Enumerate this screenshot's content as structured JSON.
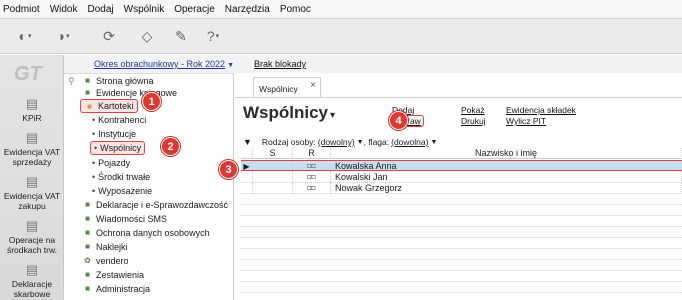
{
  "menu": [
    "Podmiot",
    "Widok",
    "Dodaj",
    "Wspólnik",
    "Operacje",
    "Narzędzia",
    "Pomoc"
  ],
  "toolbar": {
    "icons": [
      "back-icon",
      "forward-icon",
      "refresh-icon",
      "eraser-icon",
      "tools-icon",
      "help-icon"
    ]
  },
  "leftbar": {
    "logo": "GT",
    "items": [
      {
        "label": "KPiR",
        "icon": "books-icon"
      },
      {
        "label": "Ewidencja VAT sprzedaży",
        "icon": "sales-icon"
      },
      {
        "label": "Ewidencja VAT zakupu",
        "icon": "purchase-icon"
      },
      {
        "label": "Operacje na środkach trw.",
        "icon": "assets-icon"
      },
      {
        "label": "Deklaracje skarbowe",
        "icon": "declarations-icon"
      }
    ]
  },
  "infobar": {
    "period": "Okres obrachunkowy - Rok 2022",
    "lock": "Brak blokady"
  },
  "tree": {
    "items": [
      "Strona główna",
      "Ewidencje księgowe",
      "Kartoteki",
      "Kontrahenci",
      "Instytucje",
      "Wspólnicy",
      "Pojazdy",
      "Środki trwałe",
      "Wyposażenie",
      "Deklaracje i e-Sprawozdawczość",
      "Wiadomości SMS",
      "Ochrona danych osobowych",
      "Naklejki",
      "vendero",
      "Zestawienia",
      "Administracja"
    ]
  },
  "tab": {
    "label": "Wspólnicy",
    "close": "×"
  },
  "title": "Wspólnicy",
  "actions": {
    "dodaj": "Dodaj",
    "popraw": "Popraw",
    "pokaz": "Pokaż",
    "drukuj": "Drukuj",
    "ewidencja": "Ewidencja składek",
    "wylicz": "Wylicz PIT"
  },
  "filters": {
    "rodzaj_label": "Rodzaj osoby:",
    "rodzaj_value": "(dowolny)",
    "flaga_label": ", flaga:",
    "flaga_value": "(dowolna)"
  },
  "table": {
    "columns": [
      "S",
      "R",
      "Nazwisko i imię"
    ],
    "rows": [
      {
        "name": "Kowalska Anna",
        "selected": true
      },
      {
        "name": "Kowalski Jan",
        "selected": false
      },
      {
        "name": "Nowak Grzegorz",
        "selected": false
      }
    ]
  },
  "badges": [
    "1",
    "2",
    "3",
    "4"
  ],
  "colors": {
    "accent": "#e0372f",
    "selection": "#c7ddf2",
    "link": "#1a3ea8"
  }
}
